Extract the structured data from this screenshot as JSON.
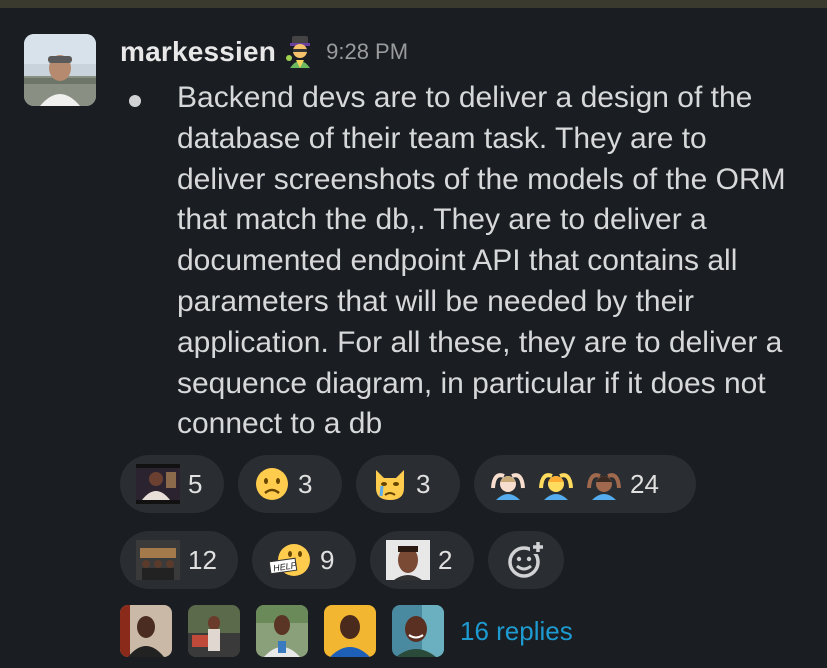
{
  "message": {
    "username": "markessien",
    "status_emoji": "ninja-emoji",
    "timestamp": "9:28 PM",
    "bullet_text": "Backend devs are to deliver a design of the database of their team task. They are to deliver screenshots of the models of the ORM that match the db,. They are to deliver a documented endpoint API that contains all parameters that will be needed by their application. For all these, they are to deliver a sequence diagram, in particular if it does not connect to a db"
  },
  "reactions": [
    {
      "emoji": "custom-image-emoji",
      "count": "5"
    },
    {
      "emoji": "frowning-face-emoji",
      "count": "3"
    },
    {
      "emoji": "crying-cat-emoji",
      "count": "3"
    },
    {
      "emojis": [
        "person-gesturing-ok-light-emoji",
        "person-gesturing-ok-emoji",
        "person-gesturing-ok-dark-emoji"
      ],
      "count": "24"
    },
    {
      "emoji": "coffin-dance-emoji",
      "count": "12"
    },
    {
      "emoji": "help-emoji",
      "count": "9"
    },
    {
      "emoji": "custom-face-emoji",
      "count": "2"
    }
  ],
  "add_reaction_icon": "add-reaction-icon",
  "thread": {
    "replies_label": "16 replies",
    "reply_avatars": 5
  }
}
